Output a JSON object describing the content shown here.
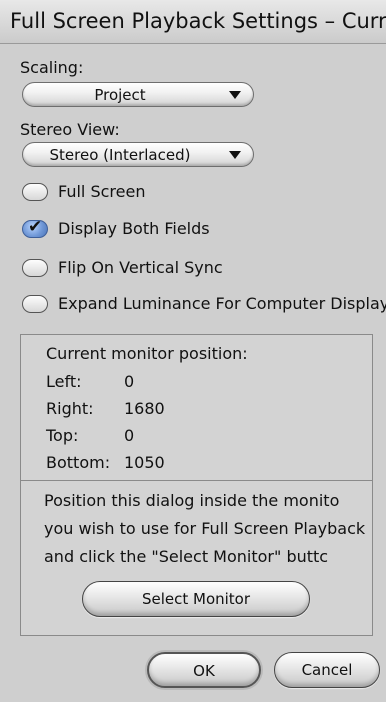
{
  "window": {
    "title": "Full Screen Playback Settings – Curr..."
  },
  "scaling": {
    "label": "Scaling:",
    "selected": "Project"
  },
  "stereo_view": {
    "label": "Stereo View:",
    "selected": "Stereo (Interlaced)"
  },
  "options": [
    {
      "label": "Full Screen",
      "checked": false
    },
    {
      "label": "Display Both Fields",
      "checked": true
    },
    {
      "label": "Flip On Vertical Sync",
      "checked": false
    },
    {
      "label": "Expand Luminance For Computer Displays",
      "checked": false
    }
  ],
  "monitor": {
    "heading": "Current monitor position:",
    "rows": [
      {
        "label": "Left:",
        "value": "0"
      },
      {
        "label": "Right:",
        "value": "1680"
      },
      {
        "label": "Top:",
        "value": "0"
      },
      {
        "label": "Bottom:",
        "value": "1050"
      }
    ]
  },
  "instructions": [
    "Position this dialog inside the monito",
    "you wish to use for Full Screen Playback",
    "and click the \"Select Monitor\" buttc"
  ],
  "buttons": {
    "select_monitor": "Select Monitor",
    "ok": "OK",
    "cancel": "Cancel"
  },
  "colors": {
    "checked_accent": "#6f97d6",
    "background": "#cfcfcf"
  }
}
